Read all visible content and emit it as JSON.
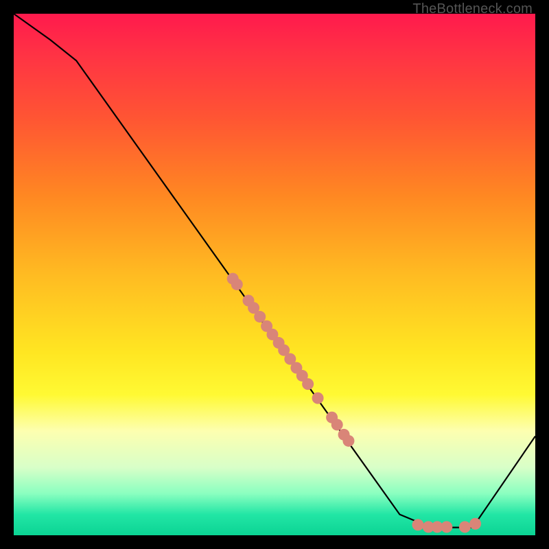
{
  "attribution": "TheBottleneck.com",
  "chart_data": {
    "type": "line",
    "title": "",
    "xlabel": "",
    "ylabel": "",
    "xlim": [
      0,
      100
    ],
    "ylim": [
      0,
      100
    ],
    "grid": false,
    "legend": false,
    "curve_points": [
      {
        "x": 0,
        "y": 100
      },
      {
        "x": 7,
        "y": 95
      },
      {
        "x": 12,
        "y": 91
      },
      {
        "x": 74,
        "y": 4
      },
      {
        "x": 80,
        "y": 1.5
      },
      {
        "x": 88,
        "y": 1.5
      },
      {
        "x": 100,
        "y": 19
      }
    ],
    "scatter_points": [
      {
        "x": 42.0,
        "y": 49.2
      },
      {
        "x": 42.8,
        "y": 48.1
      },
      {
        "x": 45.0,
        "y": 45.0
      },
      {
        "x": 46.0,
        "y": 43.6
      },
      {
        "x": 47.2,
        "y": 41.9
      },
      {
        "x": 48.5,
        "y": 40.1
      },
      {
        "x": 49.6,
        "y": 38.5
      },
      {
        "x": 50.8,
        "y": 36.9
      },
      {
        "x": 51.8,
        "y": 35.5
      },
      {
        "x": 53.0,
        "y": 33.8
      },
      {
        "x": 54.2,
        "y": 32.1
      },
      {
        "x": 55.3,
        "y": 30.6
      },
      {
        "x": 56.4,
        "y": 29.0
      },
      {
        "x": 58.3,
        "y": 26.3
      },
      {
        "x": 61.0,
        "y": 22.6
      },
      {
        "x": 62.0,
        "y": 21.2
      },
      {
        "x": 63.3,
        "y": 19.3
      },
      {
        "x": 64.2,
        "y": 18.1
      },
      {
        "x": 77.5,
        "y": 2.0
      },
      {
        "x": 79.5,
        "y": 1.6
      },
      {
        "x": 81.2,
        "y": 1.6
      },
      {
        "x": 83.0,
        "y": 1.6
      },
      {
        "x": 86.5,
        "y": 1.6
      },
      {
        "x": 88.5,
        "y": 2.2
      }
    ],
    "scatter_color": "#d98578",
    "curve_color": "#000000"
  }
}
